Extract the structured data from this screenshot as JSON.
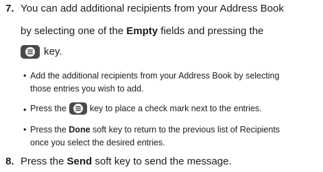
{
  "step7": {
    "number": "7.",
    "line1": "You can add additional recipients from your Address Book",
    "line2_pre": "by selecting one of the ",
    "line2_bold": "Empty",
    "line2_post": " fields and pressing the",
    "line3_post": "key.",
    "key_icon": "menu-ok-key-icon"
  },
  "bullets": [
    {
      "line1": "Add the additional recipients from your Address Book by selecting",
      "line2": "those entries you wish to add."
    },
    {
      "pre": "Press the",
      "post": "key to place a check mark next to the entries.",
      "key_icon": "menu-ok-key-icon"
    },
    {
      "line1_pre": "Press the ",
      "line1_bold": "Done",
      "line1_post": " soft key to return to the previous list of Recipients",
      "line2": "once you select the desired entries."
    }
  ],
  "step8": {
    "number": "8.",
    "pre": "Press the ",
    "bold": "Send",
    "post": " soft key to send the message."
  }
}
